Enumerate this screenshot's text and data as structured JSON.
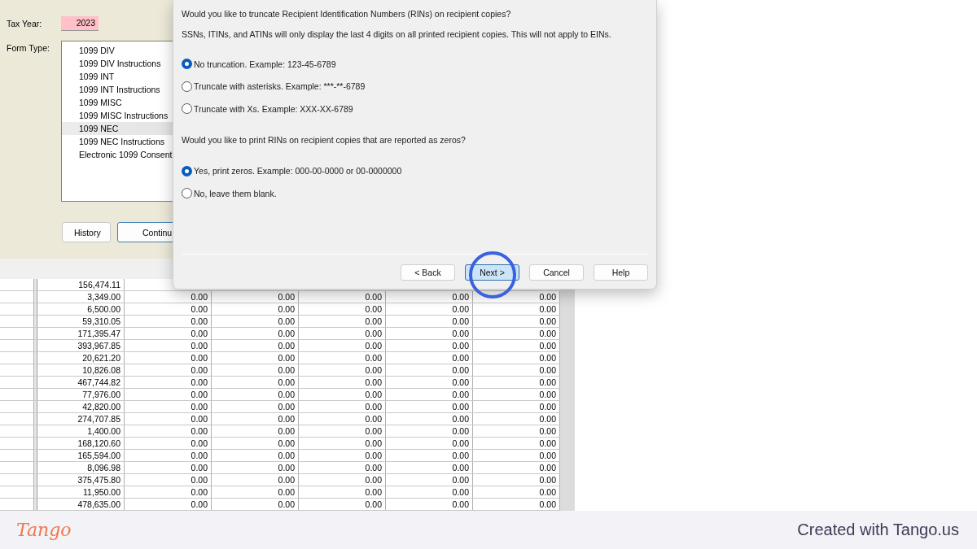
{
  "app": {
    "tax_year": {
      "label": "Tax Year:",
      "value": "2023"
    },
    "form_type": {
      "label": "Form Type:",
      "items": [
        {
          "label": "1099 DIV",
          "selected": false
        },
        {
          "label": "1099 DIV Instructions",
          "selected": false
        },
        {
          "label": "1099 INT",
          "selected": false
        },
        {
          "label": "1099 INT Instructions",
          "selected": false
        },
        {
          "label": "1099 MISC",
          "selected": false
        },
        {
          "label": "1099 MISC Instructions",
          "selected": false
        },
        {
          "label": "1099 NEC",
          "selected": true
        },
        {
          "label": "1099 NEC Instructions",
          "selected": false
        },
        {
          "label": "Electronic 1099 Consent",
          "selected": false
        }
      ]
    },
    "buttons": [
      "History",
      "Continu"
    ]
  },
  "grid": {
    "rows": [
      {
        "amount": "156,474.11",
        "values": []
      },
      {
        "amount": "3,349.00",
        "values": [
          "0.00",
          "0.00",
          "0.00",
          "0.00",
          "0.00"
        ]
      },
      {
        "amount": "6,500.00",
        "values": [
          "0.00",
          "0.00",
          "0.00",
          "0.00",
          "0.00"
        ]
      },
      {
        "amount": "59,310.05",
        "values": [
          "0.00",
          "0.00",
          "0.00",
          "0.00",
          "0.00"
        ]
      },
      {
        "amount": "171,395.47",
        "values": [
          "0.00",
          "0.00",
          "0.00",
          "0.00",
          "0.00"
        ]
      },
      {
        "amount": "393,967.85",
        "values": [
          "0.00",
          "0.00",
          "0.00",
          "0.00",
          "0.00"
        ]
      },
      {
        "amount": "20,621.20",
        "values": [
          "0.00",
          "0.00",
          "0.00",
          "0.00",
          "0.00"
        ]
      },
      {
        "amount": "10,826.08",
        "values": [
          "0.00",
          "0.00",
          "0.00",
          "0.00",
          "0.00"
        ]
      },
      {
        "amount": "467,744.82",
        "values": [
          "0.00",
          "0.00",
          "0.00",
          "0.00",
          "0.00"
        ]
      },
      {
        "amount": "77,976.00",
        "values": [
          "0.00",
          "0.00",
          "0.00",
          "0.00",
          "0.00"
        ]
      },
      {
        "amount": "42,820.00",
        "values": [
          "0.00",
          "0.00",
          "0.00",
          "0.00",
          "0.00"
        ]
      },
      {
        "amount": "274,707.85",
        "values": [
          "0.00",
          "0.00",
          "0.00",
          "0.00",
          "0.00"
        ]
      },
      {
        "amount": "1,400.00",
        "values": [
          "0.00",
          "0.00",
          "0.00",
          "0.00",
          "0.00"
        ]
      },
      {
        "amount": "168,120.60",
        "values": [
          "0.00",
          "0.00",
          "0.00",
          "0.00",
          "0.00"
        ]
      },
      {
        "amount": "165,594.00",
        "values": [
          "0.00",
          "0.00",
          "0.00",
          "0.00",
          "0.00"
        ]
      },
      {
        "amount": "8,096.98",
        "values": [
          "0.00",
          "0.00",
          "0.00",
          "0.00",
          "0.00"
        ]
      },
      {
        "amount": "375,475.80",
        "values": [
          "0.00",
          "0.00",
          "0.00",
          "0.00",
          "0.00"
        ]
      },
      {
        "amount": "11,950.00",
        "values": [
          "0.00",
          "0.00",
          "0.00",
          "0.00",
          "0.00"
        ]
      },
      {
        "amount": "478,635.00",
        "values": [
          "0.00",
          "0.00",
          "0.00",
          "0.00",
          "0.00"
        ]
      }
    ]
  },
  "dialog": {
    "sections": [
      {
        "question": "Would you like to truncate Recipient Identification Numbers (RINs) on recipient copies?",
        "note": "SSNs, ITINs, and ATINs will only display the last 4 digits on all printed recipient copies. This will not apply to EINs.",
        "options": [
          {
            "label": "No truncation. Example: 123-45-6789",
            "selected": true
          },
          {
            "label": "Truncate with asterisks. Example: ***-**-6789",
            "selected": false
          },
          {
            "label": "Truncate with Xs. Example: XXX-XX-6789",
            "selected": false
          }
        ]
      },
      {
        "question": "Would you like to print RINs on recipient copies that are reported as zeros?",
        "options": [
          {
            "label": "Yes, print zeros. Example: 000-00-0000 or 00-0000000",
            "selected": true
          },
          {
            "label": "No, leave them blank.",
            "selected": false
          }
        ]
      }
    ],
    "buttons": [
      {
        "label": "< Back",
        "focused": false
      },
      {
        "label": "Next >",
        "focused": true
      },
      {
        "label": "Cancel",
        "focused": false
      },
      {
        "label": "Help",
        "focused": false
      }
    ]
  },
  "footer": {
    "logo": "Tango",
    "text": "Created with Tango.us"
  }
}
